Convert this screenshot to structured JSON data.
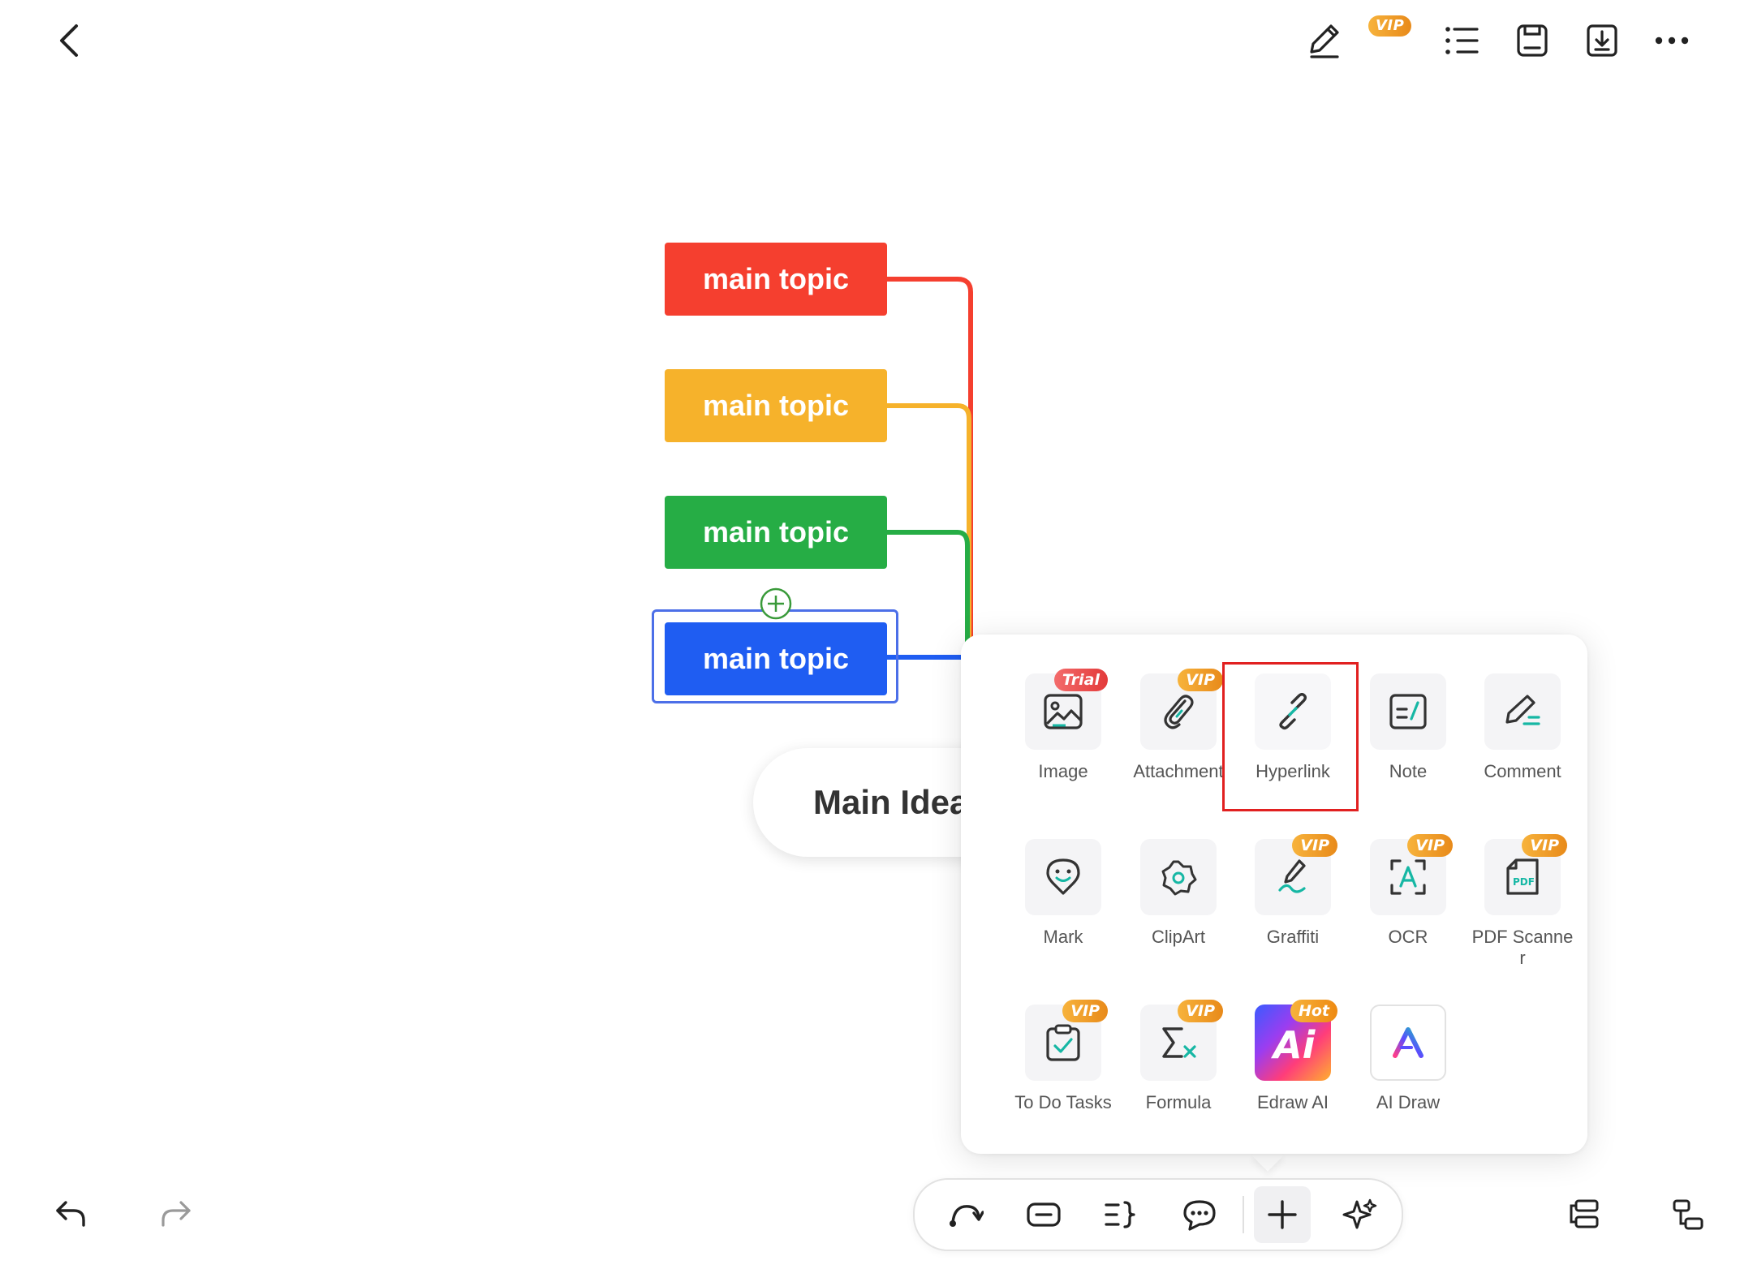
{
  "toolbar": {
    "vip_badge": "VIP",
    "icons": [
      "back-icon",
      "pen-icon",
      "list-icon",
      "save-icon",
      "download-icon",
      "more-icon"
    ]
  },
  "canvas": {
    "topics": [
      {
        "label": "main topic",
        "color": "#f53f2f"
      },
      {
        "label": "main topic",
        "color": "#f6b22b"
      },
      {
        "label": "main topic",
        "color": "#26ad45"
      },
      {
        "label": "main topic",
        "color": "#1f5df2",
        "selected": true
      }
    ],
    "central": {
      "label": "Main Idea"
    }
  },
  "insert_panel": {
    "items": [
      {
        "label": "Image",
        "badge": "Trial",
        "icon": "image-icon"
      },
      {
        "label": "Attachment",
        "badge": "VIP",
        "icon": "paperclip-icon"
      },
      {
        "label": "Hyperlink",
        "badge": "",
        "icon": "link-icon",
        "highlighted": true
      },
      {
        "label": "Note",
        "badge": "",
        "icon": "note-icon"
      },
      {
        "label": "Comment",
        "badge": "",
        "icon": "comment-pen-icon"
      },
      {
        "label": "Mark",
        "badge": "",
        "icon": "mark-icon"
      },
      {
        "label": "ClipArt",
        "badge": "",
        "icon": "clipart-icon"
      },
      {
        "label": "Graffiti",
        "badge": "VIP",
        "icon": "graffiti-icon"
      },
      {
        "label": "OCR",
        "badge": "VIP",
        "icon": "ocr-icon"
      },
      {
        "label": "PDF Scanner",
        "badge": "VIP",
        "icon": "pdf-icon"
      },
      {
        "label": "To Do Tasks",
        "badge": "VIP",
        "icon": "todo-icon"
      },
      {
        "label": "Formula",
        "badge": "VIP",
        "icon": "formula-icon"
      },
      {
        "label": "Edraw AI",
        "badge": "Hot",
        "icon": "edraw-ai-icon"
      },
      {
        "label": "AI Draw",
        "badge": "",
        "icon": "ai-draw-icon"
      }
    ]
  },
  "bottom_toolbar": {
    "icons": [
      "relationship-icon",
      "topic-icon",
      "summary-icon",
      "callout-icon",
      "insert-icon",
      "ai-sparkle-icon"
    ],
    "active": "insert-icon"
  },
  "corner": {
    "icons": [
      "undo-icon",
      "redo-icon",
      "layout-icon",
      "structure-icon"
    ]
  }
}
